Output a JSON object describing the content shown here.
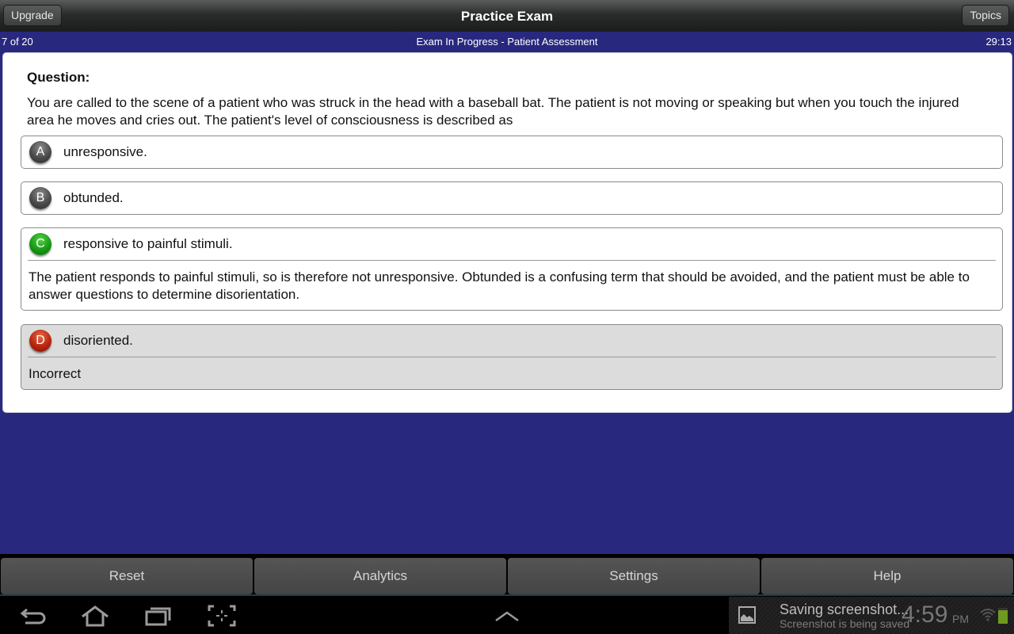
{
  "header": {
    "title": "Practice Exam",
    "left_button": "Upgrade",
    "right_button": "Topics"
  },
  "status": {
    "progress": "7 of 20",
    "subtitle": "Exam In Progress - Patient Assessment",
    "timer": "29:13"
  },
  "question": {
    "label": "Question:",
    "text": "You are called to the scene of a patient who was struck in the head with a baseball bat. The patient is not moving or speaking but when you touch the injured area he moves and cries out. The patient's level of consciousness is described as"
  },
  "answers": [
    {
      "letter": "A",
      "text": "unresponsive.",
      "state": "neutral",
      "badge_color": "#4a4a4a"
    },
    {
      "letter": "B",
      "text": "obtunded.",
      "state": "neutral",
      "badge_color": "#4a4a4a"
    },
    {
      "letter": "C",
      "text": "responsive to painful stimuli.",
      "state": "correct",
      "badge_color": "#169a14",
      "explanation": "The patient responds to painful stimuli, so is therefore not unresponsive. Obtunded is a confusing term that should be avoided, and the patient must be able to answer questions to determine disorientation."
    },
    {
      "letter": "D",
      "text": "disoriented.",
      "state": "selected-incorrect",
      "badge_color": "#b8250f",
      "explanation": "Incorrect"
    }
  ],
  "bottom_buttons": [
    "Reset",
    "Analytics",
    "Settings",
    "Help"
  ],
  "system": {
    "notification_title": "Saving screenshot...",
    "notification_subtitle": "Screenshot is being saved",
    "clock": "4:59",
    "ampm": "PM",
    "icons": [
      "back-icon",
      "home-icon",
      "recent-apps-icon",
      "screenshot-icon",
      "chevron-up-icon",
      "image-icon",
      "wifi-icon",
      "battery-icon"
    ]
  },
  "colors": {
    "background": "#29287f",
    "correct": "#169a14",
    "incorrect": "#b8250f"
  }
}
